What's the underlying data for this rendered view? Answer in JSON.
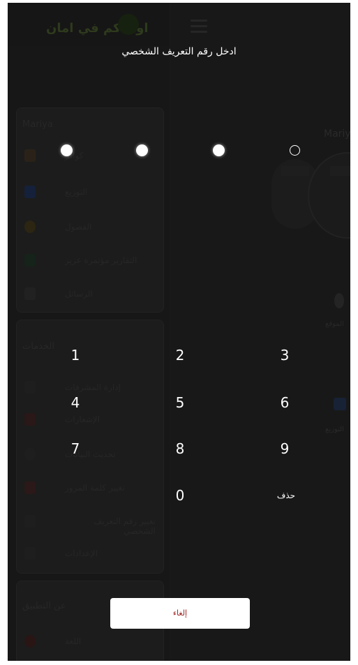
{
  "app": {
    "brand": "اولادكم في امان",
    "drawer_name": "Mariya",
    "drawer_sections": [
      {
        "title": "Mariya",
        "items": [
          "كوادر",
          "التوزيع",
          "الفصول",
          "التقارير مؤتمرة عزيز",
          "الرسائل"
        ]
      },
      {
        "title": "الخدمات",
        "items": [
          "إدارة المشرفات",
          "الإشعارات",
          "تحديث البيانات",
          "تغيير كلمة المرور",
          "تغيير رقم التعريف الشخصي",
          "الإعدادات"
        ]
      },
      {
        "title": "عن التطبيق",
        "items": [
          "اللغة"
        ]
      }
    ],
    "right_name": "Mariya",
    "location_label": "الموقع",
    "edu_label": "التوزيع"
  },
  "pin_dialog": {
    "title": "ادخل رقم التعريف الشخصي",
    "filled_count": 3,
    "total": 4,
    "keys": [
      "1",
      "2",
      "3",
      "4",
      "5",
      "6",
      "7",
      "8",
      "9",
      "0"
    ],
    "delete_label": "حذف",
    "cancel_label": "إلغاء"
  },
  "colors": {
    "overlay_bg": "#1a1a1a",
    "text": "#ffffff",
    "cancel_text": "#9b1b1b"
  }
}
